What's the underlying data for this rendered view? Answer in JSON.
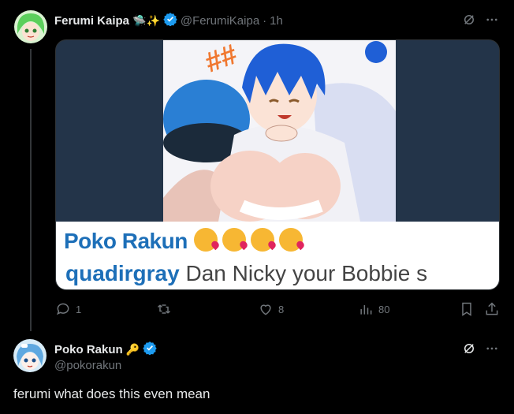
{
  "tweet": {
    "author_name": "Ferumi Kaipa",
    "author_emoji": "🛸✨",
    "handle": "@FerumiKaipa",
    "separator": "·",
    "time": "1h",
    "media": {
      "caption_name": "Poko Rakun",
      "caption_emoji": "😘😘😘😘",
      "caption_user": "quadirgray",
      "caption_text": "Dan Nicky your Bobbie s"
    },
    "stats": {
      "replies": "1",
      "reposts": "",
      "likes": "8",
      "views": "80"
    }
  },
  "reply": {
    "author_name": "Poko Rakun",
    "author_emoji": "🔑",
    "handle": "@pokorakun",
    "text": "ferumi what does this even mean"
  },
  "colors": {
    "verified": "#1d9bf0",
    "muted": "#71767b",
    "background": "#000000",
    "caption_blue": "#1d6fb8"
  }
}
